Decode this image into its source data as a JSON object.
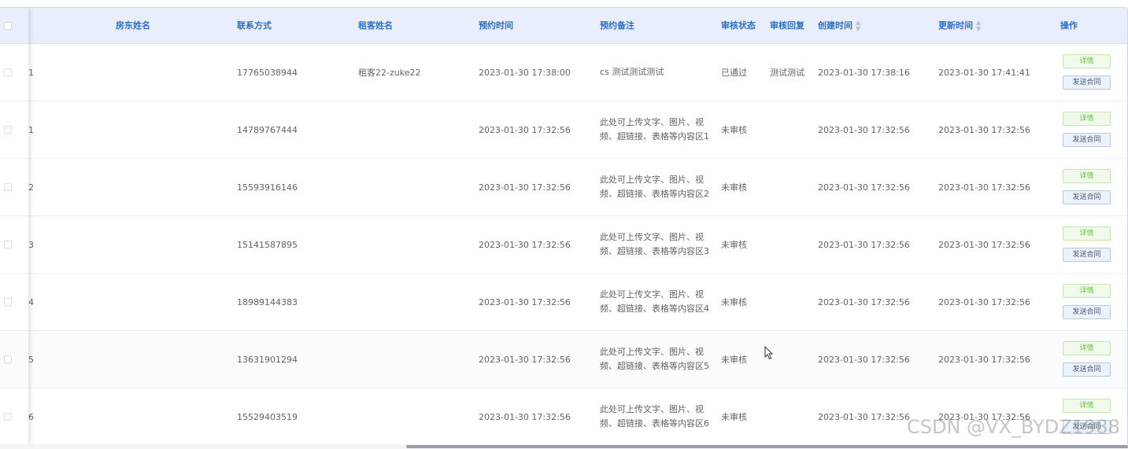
{
  "columns": {
    "landlord_name": "房东姓名",
    "contact": "联系方式",
    "tenant_name": "租客姓名",
    "appt_time": "预约时间",
    "appt_note": "预约备注",
    "review_status": "审核状态",
    "review_reply": "审核回复",
    "created_time": "创建时间",
    "updated_time": "更新时间",
    "actions": "操作"
  },
  "sort_icon": "◆",
  "buttons": {
    "detail": "详情",
    "send_contract": "发送合同"
  },
  "rows": [
    {
      "index": "1",
      "landlord": "",
      "contact": "17765038944",
      "tenant": "租客22-zuke22",
      "appt_time": "2023-01-30 17:38:00",
      "note": "cs 测试测试测试",
      "status": "已通过",
      "reply": "测试测试",
      "created": "2023-01-30 17:38:16",
      "updated": "2023-01-30 17:41:41"
    },
    {
      "index": "1",
      "landlord": "",
      "contact": "14789767444",
      "tenant": "",
      "appt_time": "2023-01-30 17:32:56",
      "note": "此处可上传文字、图片、视频、超链接、表格等内容区1",
      "status": "未审核",
      "reply": "",
      "created": "2023-01-30 17:32:56",
      "updated": "2023-01-30 17:32:56"
    },
    {
      "index": "2",
      "landlord": "",
      "contact": "15593916146",
      "tenant": "",
      "appt_time": "2023-01-30 17:32:56",
      "note": "此处可上传文字、图片、视频、超链接、表格等内容区2",
      "status": "未审核",
      "reply": "",
      "created": "2023-01-30 17:32:56",
      "updated": "2023-01-30 17:32:56"
    },
    {
      "index": "3",
      "landlord": "",
      "contact": "15141587895",
      "tenant": "",
      "appt_time": "2023-01-30 17:32:56",
      "note": "此处可上传文字、图片、视频、超链接、表格等内容区3",
      "status": "未审核",
      "reply": "",
      "created": "2023-01-30 17:32:56",
      "updated": "2023-01-30 17:32:56"
    },
    {
      "index": "4",
      "landlord": "",
      "contact": "18989144383",
      "tenant": "",
      "appt_time": "2023-01-30 17:32:56",
      "note": "此处可上传文字、图片、视频、超链接、表格等内容区4",
      "status": "未审核",
      "reply": "",
      "created": "2023-01-30 17:32:56",
      "updated": "2023-01-30 17:32:56"
    },
    {
      "index": "5",
      "landlord": "",
      "contact": "13631901294",
      "tenant": "",
      "appt_time": "2023-01-30 17:32:56",
      "note": "此处可上传文字、图片、视频、超链接、表格等内容区5",
      "status": "未审核",
      "reply": "",
      "created": "2023-01-30 17:32:56",
      "updated": "2023-01-30 17:32:56"
    },
    {
      "index": "6",
      "landlord": "",
      "contact": "15529403519",
      "tenant": "",
      "appt_time": "2023-01-30 17:32:56",
      "note": "此处可上传文字、图片、视频、超链接、表格等内容区6",
      "status": "未审核",
      "reply": "",
      "created": "2023-01-30 17:32:56",
      "updated": "2023-01-30 17:32:56"
    }
  ],
  "watermark": "CSDN @VX_BYDZ1988",
  "colors": {
    "header_bg": "#e8eefb",
    "header_text": "#2f6fbf",
    "detail_green": "#67c23a"
  }
}
